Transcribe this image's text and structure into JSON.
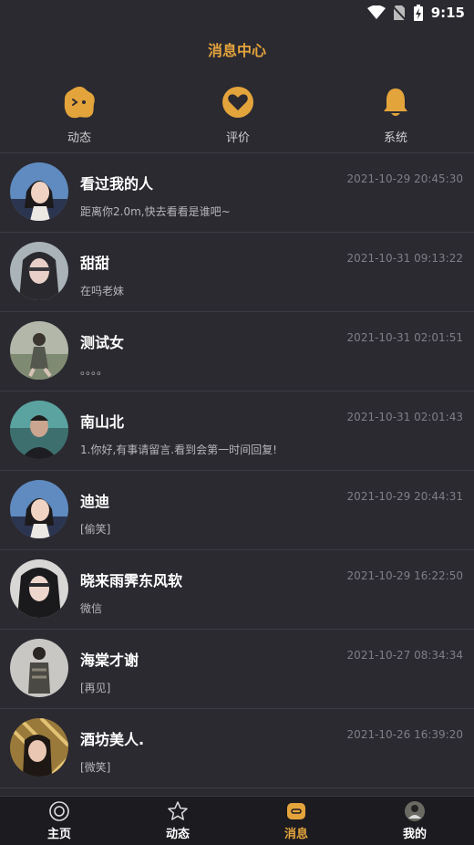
{
  "status": {
    "time": "9:15"
  },
  "header": {
    "title": "消息中心"
  },
  "quick_actions": [
    {
      "label": "动态",
      "icon": "dynamic-face-icon"
    },
    {
      "label": "评价",
      "icon": "heart-icon"
    },
    {
      "label": "系统",
      "icon": "bell-icon"
    }
  ],
  "messages": [
    {
      "name": "看过我的人",
      "time": "2021-10-29 20:45:30",
      "preview": "距离你2.0m,快去看看是谁吧~"
    },
    {
      "name": "甜甜",
      "time": "2021-10-31 09:13:22",
      "preview": "在吗老妹"
    },
    {
      "name": "测试女",
      "time": "2021-10-31 02:01:51",
      "preview": "。。。。"
    },
    {
      "name": "南山北",
      "time": "2021-10-31 02:01:43",
      "preview": "1.你好,有事请留言.看到会第一时间回复!"
    },
    {
      "name": "迪迪",
      "time": "2021-10-29 20:44:31",
      "preview": "[偷笑]"
    },
    {
      "name": "晓来雨霁东风软",
      "time": "2021-10-29 16:22:50",
      "preview": "微信"
    },
    {
      "name": "海棠才谢",
      "time": "2021-10-27 08:34:34",
      "preview": "[再见]"
    },
    {
      "name": "酒坊美人.",
      "time": "2021-10-26 16:39:20",
      "preview": "[微笑]"
    }
  ],
  "tabbar": [
    {
      "label": "主页",
      "icon": "home-ring-icon",
      "active": false
    },
    {
      "label": "动态",
      "icon": "star-icon",
      "active": false
    },
    {
      "label": "消息",
      "icon": "message-icon",
      "active": true
    },
    {
      "label": "我的",
      "icon": "profile-avatar-icon",
      "active": false
    }
  ],
  "colors": {
    "accent": "#e4a43c",
    "background": "#2b2a31",
    "tabbar": "#1c1b20"
  }
}
